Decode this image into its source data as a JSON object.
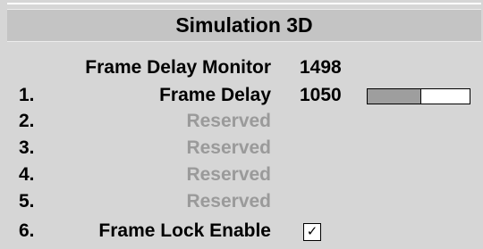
{
  "menu": {
    "title": "Simulation 3D",
    "monitor": {
      "label": "Frame Delay Monitor",
      "value": "1498"
    },
    "items": [
      {
        "num": "1.",
        "label": "Frame Delay",
        "value": "1050",
        "slider_level": 0.52,
        "enabled": true
      },
      {
        "num": "2.",
        "label": "Reserved",
        "enabled": false
      },
      {
        "num": "3.",
        "label": "Reserved",
        "enabled": false
      },
      {
        "num": "4.",
        "label": "Reserved",
        "enabled": false
      },
      {
        "num": "5.",
        "label": "Reserved",
        "enabled": false
      },
      {
        "num": "6.",
        "label": "Frame Lock Enable",
        "checked": true,
        "check_glyph": "✓",
        "enabled": true
      }
    ]
  },
  "colors": {
    "panel_background": "#d6d6d6",
    "title_background": "#c4c4c4",
    "disabled_text": "#9a9a9a",
    "slider_fill": "#9e9e9e"
  }
}
